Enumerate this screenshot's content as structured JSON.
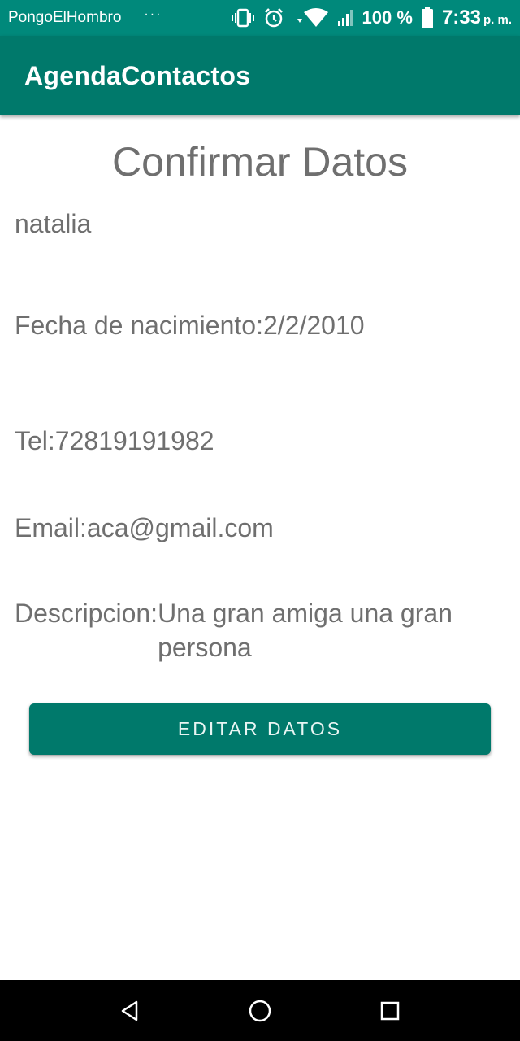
{
  "status_bar": {
    "carrier": "PongoElHombro",
    "more_dots": "···",
    "battery_percent": "100 %",
    "time": "7:33",
    "ampm": "p. m."
  },
  "app_bar": {
    "title": "AgendaContactos"
  },
  "main": {
    "title": "Confirmar Datos",
    "name": "natalia",
    "birthdate": "Fecha de nacimiento:2/2/2010",
    "phone": "Tel:72819191982",
    "email": "Email:aca@gmail.com",
    "description_label": "Descripcion:",
    "description_value": "Una gran amiga una gran persona",
    "edit_button": "EDITAR DATOS"
  },
  "nav_bar": {
    "icons": [
      "back-icon",
      "home-icon",
      "recents-icon"
    ]
  },
  "colors": {
    "status_bar": "#00897b",
    "app_bar": "#00796b",
    "button": "#00796b",
    "text": "#6f6f6f"
  }
}
